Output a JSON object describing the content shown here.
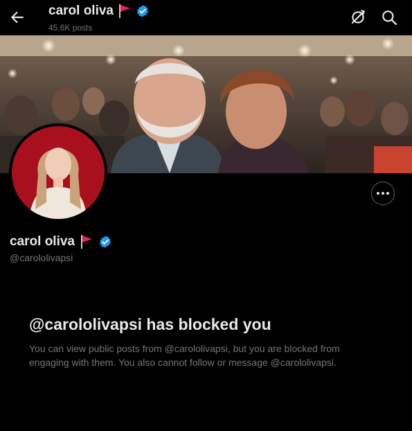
{
  "header": {
    "title": "carol oliva",
    "posts": "45.6K posts",
    "icons": [
      "arrow-left-icon",
      "flag-icon",
      "verified-badge-icon",
      "refresh-off-icon",
      "search-icon"
    ]
  },
  "profile": {
    "name": "carol oliva",
    "handle": "@carololivapsi",
    "more_icon": "ellipsis-icon"
  },
  "blocked": {
    "title": "@carololivapsi has blocked you",
    "message": "You can view public posts from @carololivapsi, but you are blocked from engaging with them. You also cannot follow or message @carololivapsi."
  },
  "colors": {
    "background": "#000000",
    "text": "#e7e9ea",
    "secondary_text": "#71767b",
    "verified": "#1d9bf0",
    "flag": "#e0245e",
    "avatar_bg": "#a8101e"
  }
}
